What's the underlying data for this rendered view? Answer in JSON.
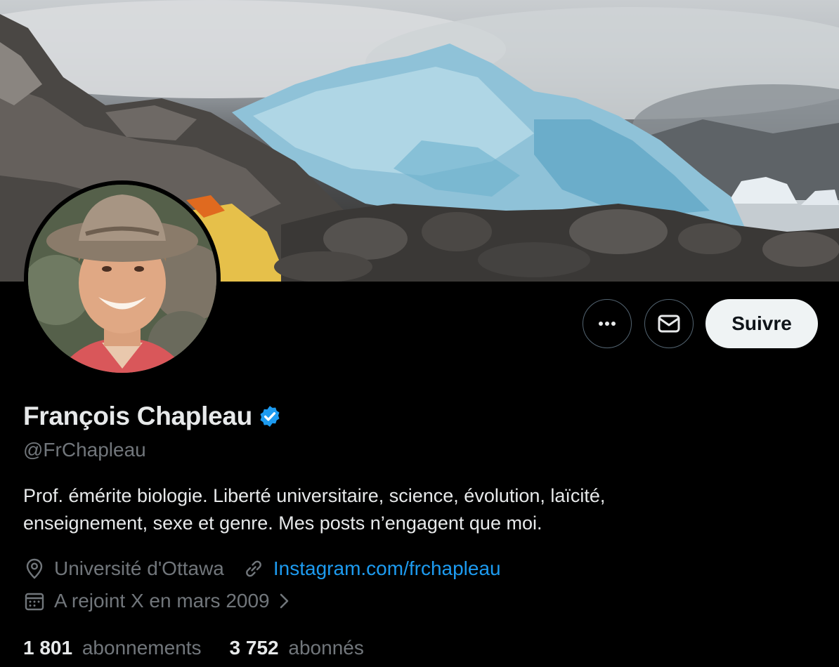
{
  "profile": {
    "name": "François Chapleau",
    "handle": "@FrChapleau",
    "bio_lines": [
      "Prof. émérite biologie. Liberté universitaire, science, évolution, laïcité,",
      "enseignement, sexe et genre. Mes posts n’engagent que moi."
    ],
    "location": "Université d'Ottawa",
    "website": "Instagram.com/frchapleau",
    "joined": "A rejoint X en mars 2009",
    "following_count": "1 801",
    "following_label": "abonnements",
    "followers_count": "3 752",
    "followers_label": "abonnés",
    "verified": true
  },
  "actions": {
    "follow_label": "Suivre",
    "more_icon": "more-horizontal-icon",
    "message_icon": "envelope-icon"
  },
  "colors": {
    "background": "#000000",
    "text_primary": "#e7e9ea",
    "text_secondary": "#71767b",
    "link": "#1d9bf0",
    "verified_badge": "#1d9bf0",
    "follow_button_bg": "#eff3f4"
  }
}
